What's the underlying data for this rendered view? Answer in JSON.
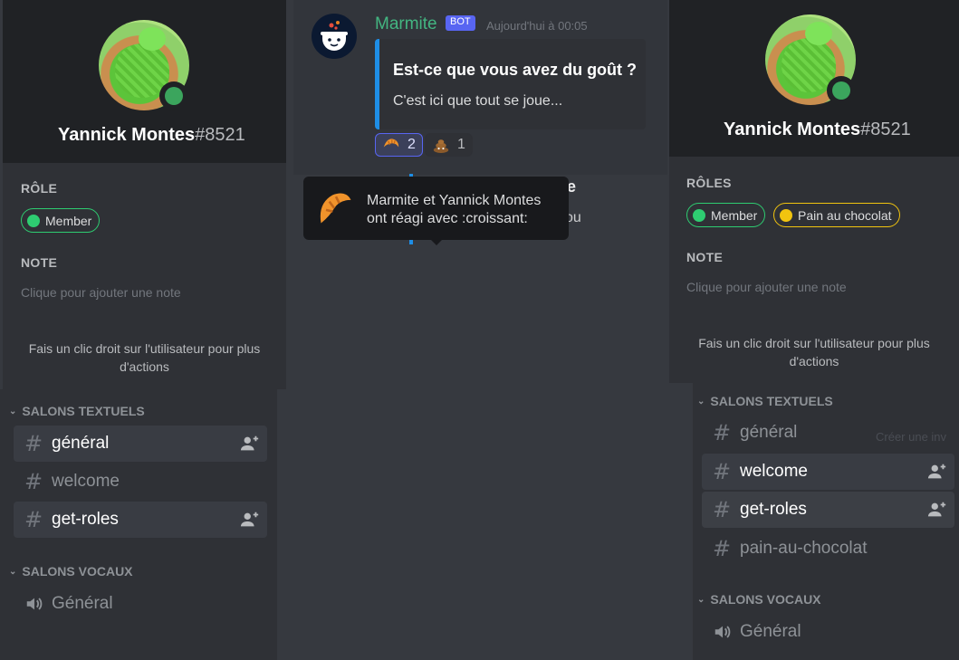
{
  "colors": {
    "online": "#3ba55d",
    "role_member": "#2ecc71",
    "role_pain_au_chocolat": "#f1c40f",
    "bot_tag": "#5865f2",
    "embed_border": "#1e8ee6"
  },
  "left_profile": {
    "username": "Yannick Montes",
    "discriminator": "#8521",
    "role_section": "RÔLE",
    "roles": [
      "Member"
    ],
    "note_section": "NOTE",
    "note_placeholder": "Clique pour ajouter une note",
    "hint": "Fais un clic droit sur l'utilisateur pour plus d'actions"
  },
  "right_profile": {
    "username": "Yannick Montes",
    "discriminator": "#8521",
    "role_section": "RÔLES",
    "roles": [
      "Member",
      "Pain au chocolat"
    ],
    "note_section": "NOTE",
    "note_placeholder": "Clique pour ajouter une note",
    "hint": "Fais un clic droit sur l'utilisateur pour plus d'actions"
  },
  "left_channels": {
    "text_category": "SALONS TEXTUELS",
    "text_channels": [
      "général",
      "welcome",
      "get-roles"
    ],
    "voice_category": "SALONS VOCAUX",
    "voice_channels": [
      "Général"
    ]
  },
  "right_channels": {
    "text_category": "SALONS TEXTUELS",
    "text_channels": [
      "général",
      "welcome",
      "get-roles",
      "pain-au-chocolat"
    ],
    "voice_category": "SALONS VOCAUX",
    "voice_channels": [
      "Général"
    ],
    "faint_text": "Créer une inv"
  },
  "message": {
    "author": "Marmite",
    "bot_tag": "BOT",
    "timestamp": "Aujourd'hui à 00:05",
    "embed_title": "Est-ce que vous avez du goût ?",
    "embed_description": "C'est ici que tout se joue...",
    "reactions": [
      {
        "emoji": "croissant",
        "count": "2"
      },
      {
        "emoji": "poop",
        "count": "1"
      }
    ],
    "behind_tooltip_right_a": "e",
    "behind_tooltip_right_b": "ou"
  },
  "tooltip": {
    "line1": "Marmite et Yannick Montes",
    "line2": "ont réagi avec :croissant:"
  }
}
